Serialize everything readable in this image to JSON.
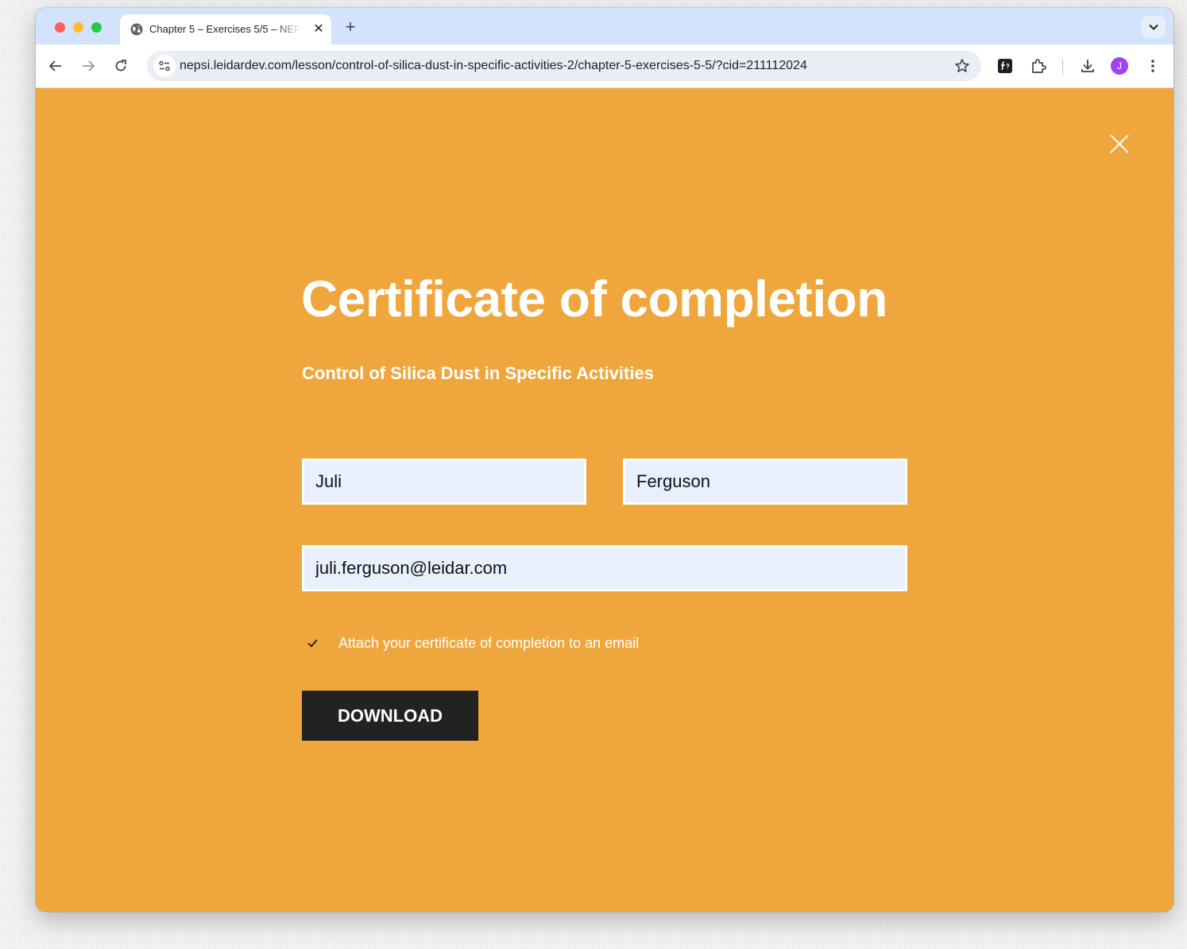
{
  "browser": {
    "tab_title": "Chapter 5 – Exercises 5/5 – NEPSI",
    "tab_close_glyph": "✕",
    "new_tab_glyph": "+",
    "url": "nepsi.leidardev.com/lesson/control-of-silica-dust-in-specific-activities-2/chapter-5-exercises-5-5/?cid=211112024",
    "profile_initial": "J",
    "profile_color": "#a142f4",
    "toolbar_icons": [
      "back-arrow-icon",
      "forward-arrow-icon",
      "reload-icon",
      "site-info-icon",
      "bookmark-star-icon",
      "extension-f-icon",
      "puzzle-extensions-icon",
      "download-icon",
      "more-menu-icon"
    ]
  },
  "page": {
    "background_color": "#efa63c",
    "title": "Certificate of completion",
    "subtitle": "Control of Silica Dust in Specific Activities",
    "form": {
      "first_name": "Juli",
      "last_name": "Ferguson",
      "email": "juli.ferguson@leidar.com",
      "attach_label": "Attach your certificate of completion to an email",
      "attach_checked": true,
      "download_label": "DOWNLOAD"
    }
  }
}
